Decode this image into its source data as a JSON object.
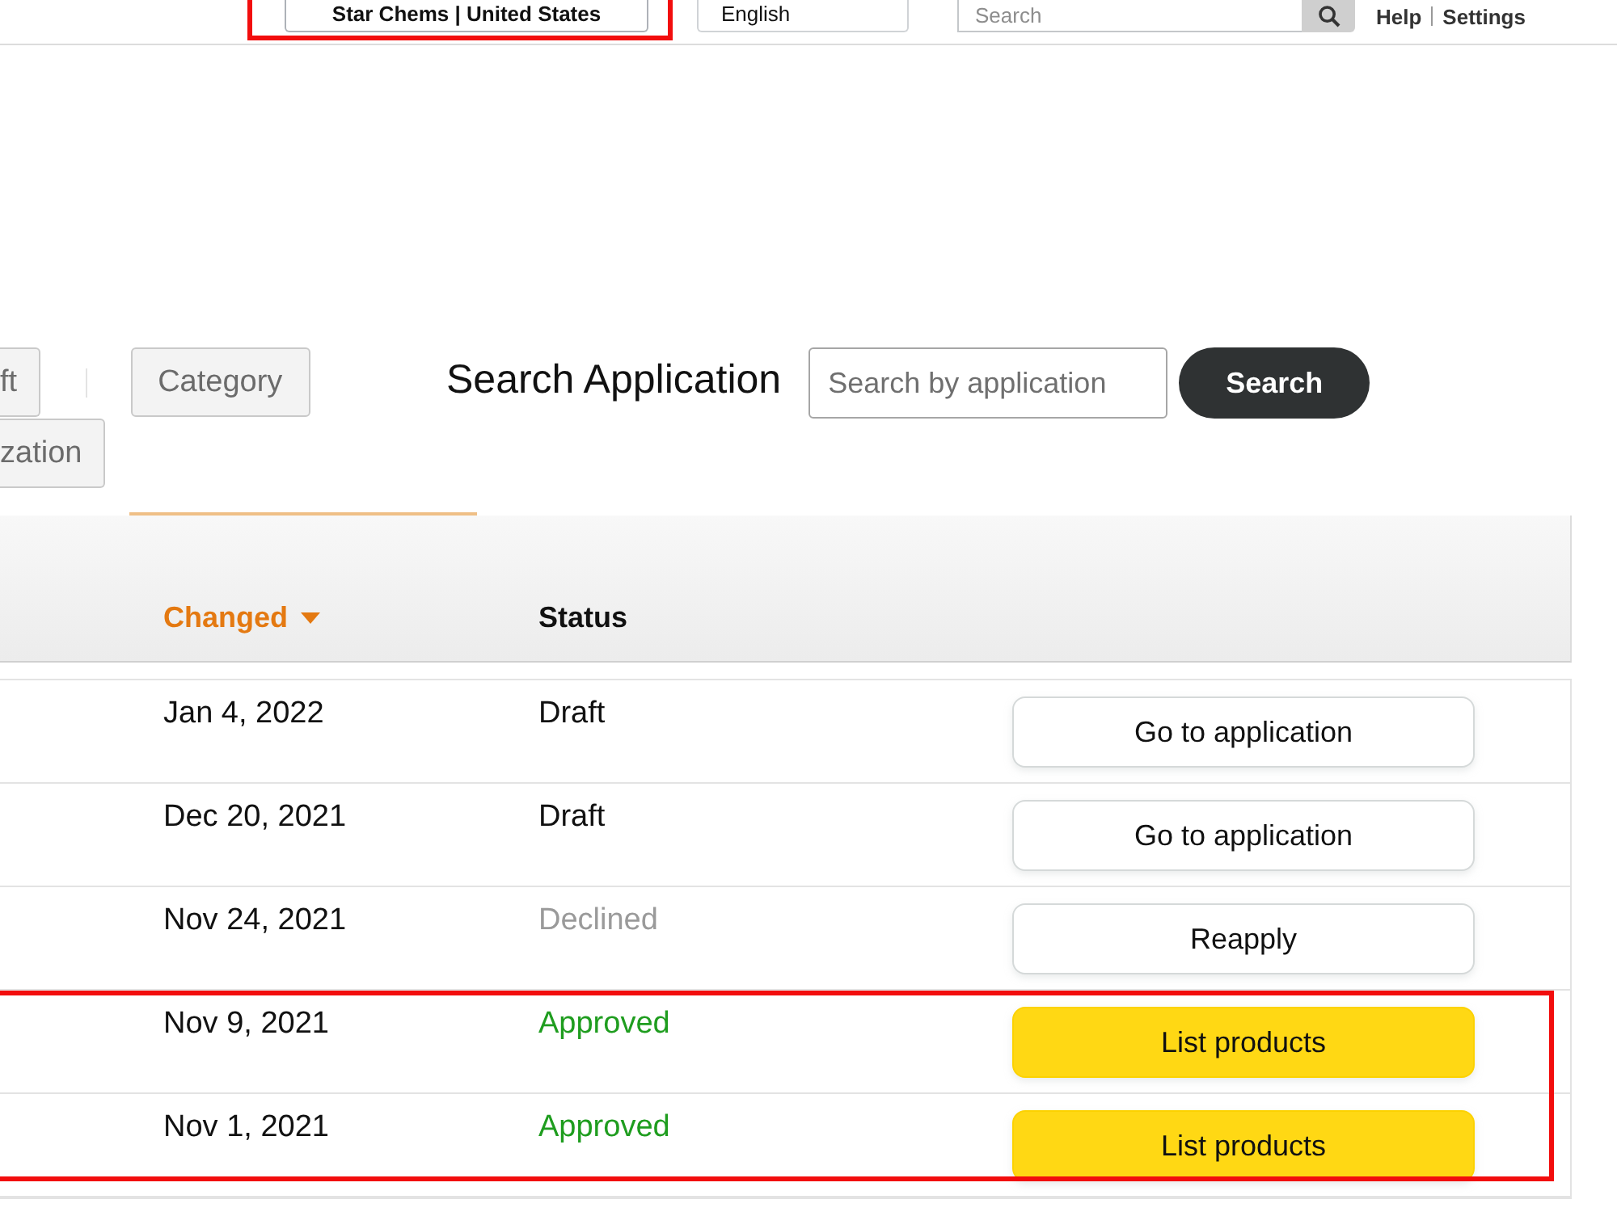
{
  "header": {
    "store_selector": {
      "label": "Star Chems | United States",
      "highlighted": true
    },
    "language": {
      "label": "English"
    },
    "search": {
      "placeholder": "Search"
    },
    "links": [
      "Help",
      "Settings"
    ]
  },
  "filter_rows": [
    {
      "buttons": [
        "ft",
        "Category"
      ]
    },
    {
      "buttons": [
        "zation"
      ]
    }
  ],
  "search_application": {
    "title": "Search Application",
    "placeholder": "Search by application",
    "button": "Search"
  },
  "table": {
    "columns": [
      {
        "label": "Changed",
        "sorted": true
      },
      {
        "label": "Status",
        "sorted": false
      }
    ],
    "rows": [
      {
        "changed": "Jan 4, 2022",
        "status": {
          "text": "Draft",
          "kind": "draft"
        },
        "action": {
          "label": "Go to application",
          "kind": "secondary"
        },
        "highlighted": false
      },
      {
        "changed": "Dec 20, 2021",
        "status": {
          "text": "Draft",
          "kind": "draft"
        },
        "action": {
          "label": "Go to application",
          "kind": "secondary"
        },
        "highlighted": false
      },
      {
        "changed": "Nov 24, 2021",
        "status": {
          "text": "Declined",
          "kind": "declined"
        },
        "action": {
          "label": "Reapply",
          "kind": "secondary"
        },
        "highlighted": false
      },
      {
        "changed": "Nov 9, 2021",
        "status": {
          "text": "Approved",
          "kind": "approved"
        },
        "action": {
          "label": "List products",
          "kind": "primary"
        },
        "highlighted": true
      },
      {
        "changed": "Nov 1, 2021",
        "status": {
          "text": "Approved",
          "kind": "approved"
        },
        "action": {
          "label": "List products",
          "kind": "primary"
        },
        "highlighted": true
      }
    ]
  }
}
